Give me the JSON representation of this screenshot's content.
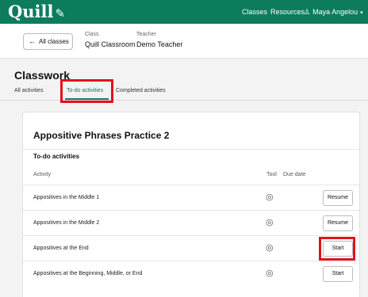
{
  "header": {
    "logo": "Quill",
    "logo_glyph": "✎",
    "nav": {
      "classes": "Classes",
      "resources": "Resources",
      "user": "Maya Angelou"
    },
    "user_glyph": "♙",
    "caret_glyph": "▾"
  },
  "class_bar": {
    "back_arrow": "←",
    "back_label": "All classes",
    "class_label": "Class",
    "class_value": "Quill Classroom",
    "teacher_label": "Teacher",
    "teacher_value": "Demo Teacher"
  },
  "page": {
    "title": "Classwork",
    "tabs": [
      {
        "label": "All activities"
      },
      {
        "label": "To-do activities",
        "active": true
      },
      {
        "label": "Completed activities"
      }
    ]
  },
  "unit": {
    "title": "Appositive Phrases Practice 2",
    "section_title": "To-do activities",
    "columns": {
      "activity": "Activity",
      "tool": "Tool",
      "due": "Due date"
    },
    "tool_icon": "target-icon",
    "tool_glyph": "◎",
    "rows": [
      {
        "name": "Appositives in the Middle 1",
        "action": "Resume"
      },
      {
        "name": "Appositives in the Middle 2",
        "action": "Resume"
      },
      {
        "name": "Appositives at the End",
        "action": "Start"
      },
      {
        "name": "Appositives at the Beginning, Middle, or End",
        "action": "Start"
      }
    ]
  },
  "colors": {
    "brand": "#0c7c5d",
    "highlight": "#e5111b",
    "background": "#f3f3f3"
  }
}
